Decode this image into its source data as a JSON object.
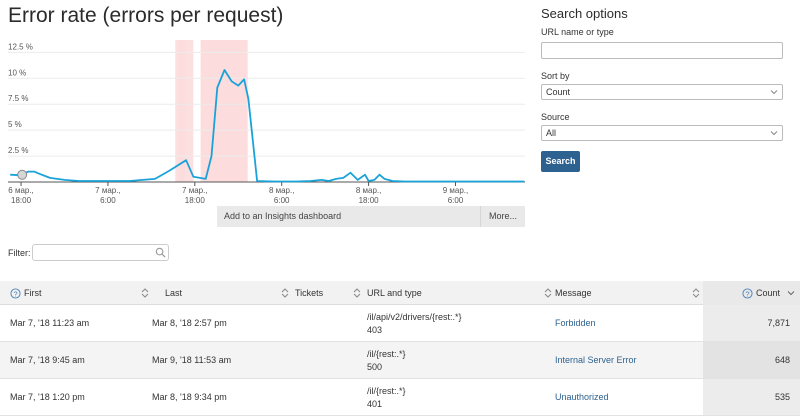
{
  "chart_data": {
    "type": "line",
    "title": "Error rate (errors per request)",
    "xlabel": "",
    "ylabel": "",
    "y_ticks": [
      "2.5 %",
      "5 %",
      "7.5 %",
      "10 %",
      "12.5 %"
    ],
    "x_ticks": [
      {
        "line1": "6 мар.,",
        "line2": "18:00",
        "t": 9
      },
      {
        "line1": "7 мар.,",
        "line2": "6:00",
        "t": 21
      },
      {
        "line1": "7 мар.,",
        "line2": "18:00",
        "t": 33
      },
      {
        "line1": "8 мар.,",
        "line2": "6:00",
        "t": 45
      },
      {
        "line1": "8 мар.,",
        "line2": "18:00",
        "t": 57
      },
      {
        "line1": "9 мар.,",
        "line2": "6:00",
        "t": 69
      }
    ],
    "ylim": [
      0,
      13.5
    ],
    "xlim": [
      7.2,
      78.6
    ],
    "grid": true,
    "series_color": "#1aa3d9",
    "highlight_color": "#fcdcdc",
    "highlight_spans": [
      [
        30.3,
        31.6
      ],
      [
        30.8,
        32.8
      ],
      [
        33.8,
        40.3
      ]
    ],
    "series": [
      {
        "x": [
          7.5,
          9,
          10,
          10.8,
          11.5,
          13,
          15,
          17,
          20,
          24,
          27.5,
          29.5,
          31.8,
          32.8,
          34.5,
          35.3,
          36.1,
          37.1,
          38.1,
          39.0,
          39.8,
          40.4,
          41.6,
          44,
          47,
          49,
          50.5,
          51.5,
          52.5,
          53.5,
          54.5,
          55.5,
          56.5,
          57,
          57.8,
          58.5,
          59.2,
          60.3,
          62,
          66,
          70,
          74,
          78.5
        ],
        "y": [
          0.7,
          0.65,
          1.0,
          1.0,
          0.8,
          0.4,
          0.2,
          0.1,
          0.1,
          0.1,
          0.3,
          1.1,
          2.1,
          0.5,
          0.3,
          2.5,
          9.1,
          10.8,
          9.7,
          9.3,
          9.9,
          8.0,
          0.1,
          0.05,
          0.05,
          0.1,
          0.2,
          0.1,
          0.3,
          0.4,
          0.9,
          0.2,
          0.7,
          0.1,
          0.2,
          0.7,
          0.3,
          0.1,
          0.05,
          0.05,
          0.05,
          0.05,
          0.05
        ]
      }
    ],
    "toolbar": {
      "insights": "Add to an Insights dashboard",
      "more": "More..."
    }
  },
  "filter": {
    "label": "Filter:",
    "value": "",
    "placeholder": ""
  },
  "search_options": {
    "title": "Search options",
    "url_label": "URL name or type",
    "url_value": "",
    "sort_label": "Sort by",
    "sort_value": "Count",
    "source_label": "Source",
    "source_value": "All",
    "search_button": "Search"
  },
  "table": {
    "headers": {
      "first": "First",
      "last": "Last",
      "tickets": "Tickets",
      "url": "URL and type",
      "message": "Message",
      "count": "Count"
    },
    "rows": [
      {
        "first": "Mar 7, '18 11:23 am",
        "last": "Mar 8, '18 2:57 pm",
        "url": "/il/api/v2/drivers/{rest:.*}",
        "type": "403",
        "message": "Forbidden",
        "count": "7,871"
      },
      {
        "first": "Mar 7, '18 9:45 am",
        "last": "Mar 9, '18 11:53 am",
        "url": "/il/{rest:.*}",
        "type": "500",
        "message": "Internal Server Error",
        "count": "648"
      },
      {
        "first": "Mar 7, '18 1:20 pm",
        "last": "Mar 8, '18 9:34 pm",
        "url": "/il/{rest:.*}",
        "type": "401",
        "message": "Unauthorized",
        "count": "535"
      }
    ]
  }
}
